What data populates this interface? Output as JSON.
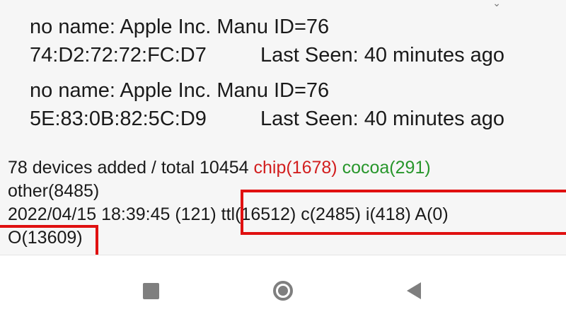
{
  "devices": [
    {
      "name": "no name:  Apple Inc.  Manu ID=76",
      "mac": "74:D2:72:72:FC:D7",
      "last_seen": "Last Seen: 40 minutes ago"
    },
    {
      "name": "no name:  Apple Inc.  Manu ID=76",
      "mac": "5E:83:0B:82:5C:D9",
      "last_seen": "Last Seen: 40 minutes ago"
    }
  ],
  "stats": {
    "added_total": "78 devices added / total 10454",
    "chip": "chip(1678)",
    "cocoa": "cocoa(291)",
    "other": "other(8485)",
    "timestamp": "2022/04/15 18:39:45 (121)",
    "breakdown": "ttl(16512) c(2485) i(418) A(0)",
    "o_count": "O(13609)"
  },
  "colors": {
    "chip": "#d21f1f",
    "cocoa": "#27962b",
    "highlight": "#e01010",
    "nav_icon": "#7f7f7f"
  },
  "nav": {
    "recents_icon": "square-icon",
    "home_icon": "circle-icon",
    "back_icon": "triangle-back-icon"
  }
}
